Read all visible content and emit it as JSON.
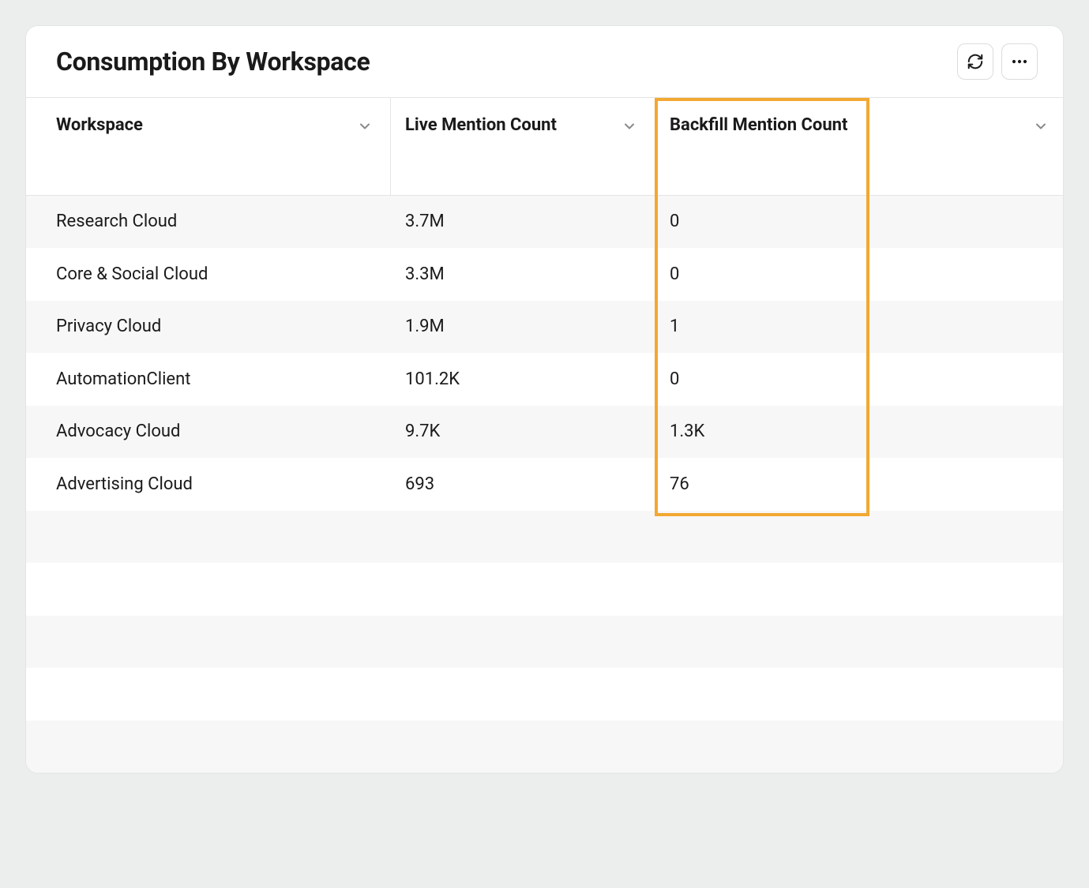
{
  "card": {
    "title": "Consumption By Workspace"
  },
  "table": {
    "columns": [
      {
        "label": "Workspace"
      },
      {
        "label": "Live Mention Count"
      },
      {
        "label": "Backfill Mention Count"
      }
    ],
    "rows": [
      {
        "workspace": "Research Cloud",
        "live": "3.7M",
        "backfill": "0"
      },
      {
        "workspace": "Core & Social Cloud",
        "live": "3.3M",
        "backfill": "0"
      },
      {
        "workspace": "Privacy Cloud",
        "live": "1.9M",
        "backfill": "1"
      },
      {
        "workspace": "AutomationClient",
        "live": "101.2K",
        "backfill": "0"
      },
      {
        "workspace": "Advocacy Cloud",
        "live": "9.7K",
        "backfill": "1.3K"
      },
      {
        "workspace": "Advertising Cloud",
        "live": "693",
        "backfill": "76"
      },
      {
        "workspace": "",
        "live": "",
        "backfill": ""
      },
      {
        "workspace": "",
        "live": "",
        "backfill": ""
      },
      {
        "workspace": "",
        "live": "",
        "backfill": ""
      },
      {
        "workspace": "",
        "live": "",
        "backfill": ""
      },
      {
        "workspace": "",
        "live": "",
        "backfill": ""
      }
    ]
  },
  "chart_data": {
    "type": "table",
    "title": "Consumption By Workspace",
    "columns": [
      "Workspace",
      "Live Mention Count",
      "Backfill Mention Count"
    ],
    "rows": [
      [
        "Research Cloud",
        "3.7M",
        "0"
      ],
      [
        "Core & Social Cloud",
        "3.3M",
        "0"
      ],
      [
        "Privacy Cloud",
        "1.9M",
        "1"
      ],
      [
        "AutomationClient",
        "101.2K",
        "0"
      ],
      [
        "Advocacy Cloud",
        "9.7K",
        "1.3K"
      ],
      [
        "Advertising Cloud",
        "693",
        "76"
      ]
    ]
  }
}
